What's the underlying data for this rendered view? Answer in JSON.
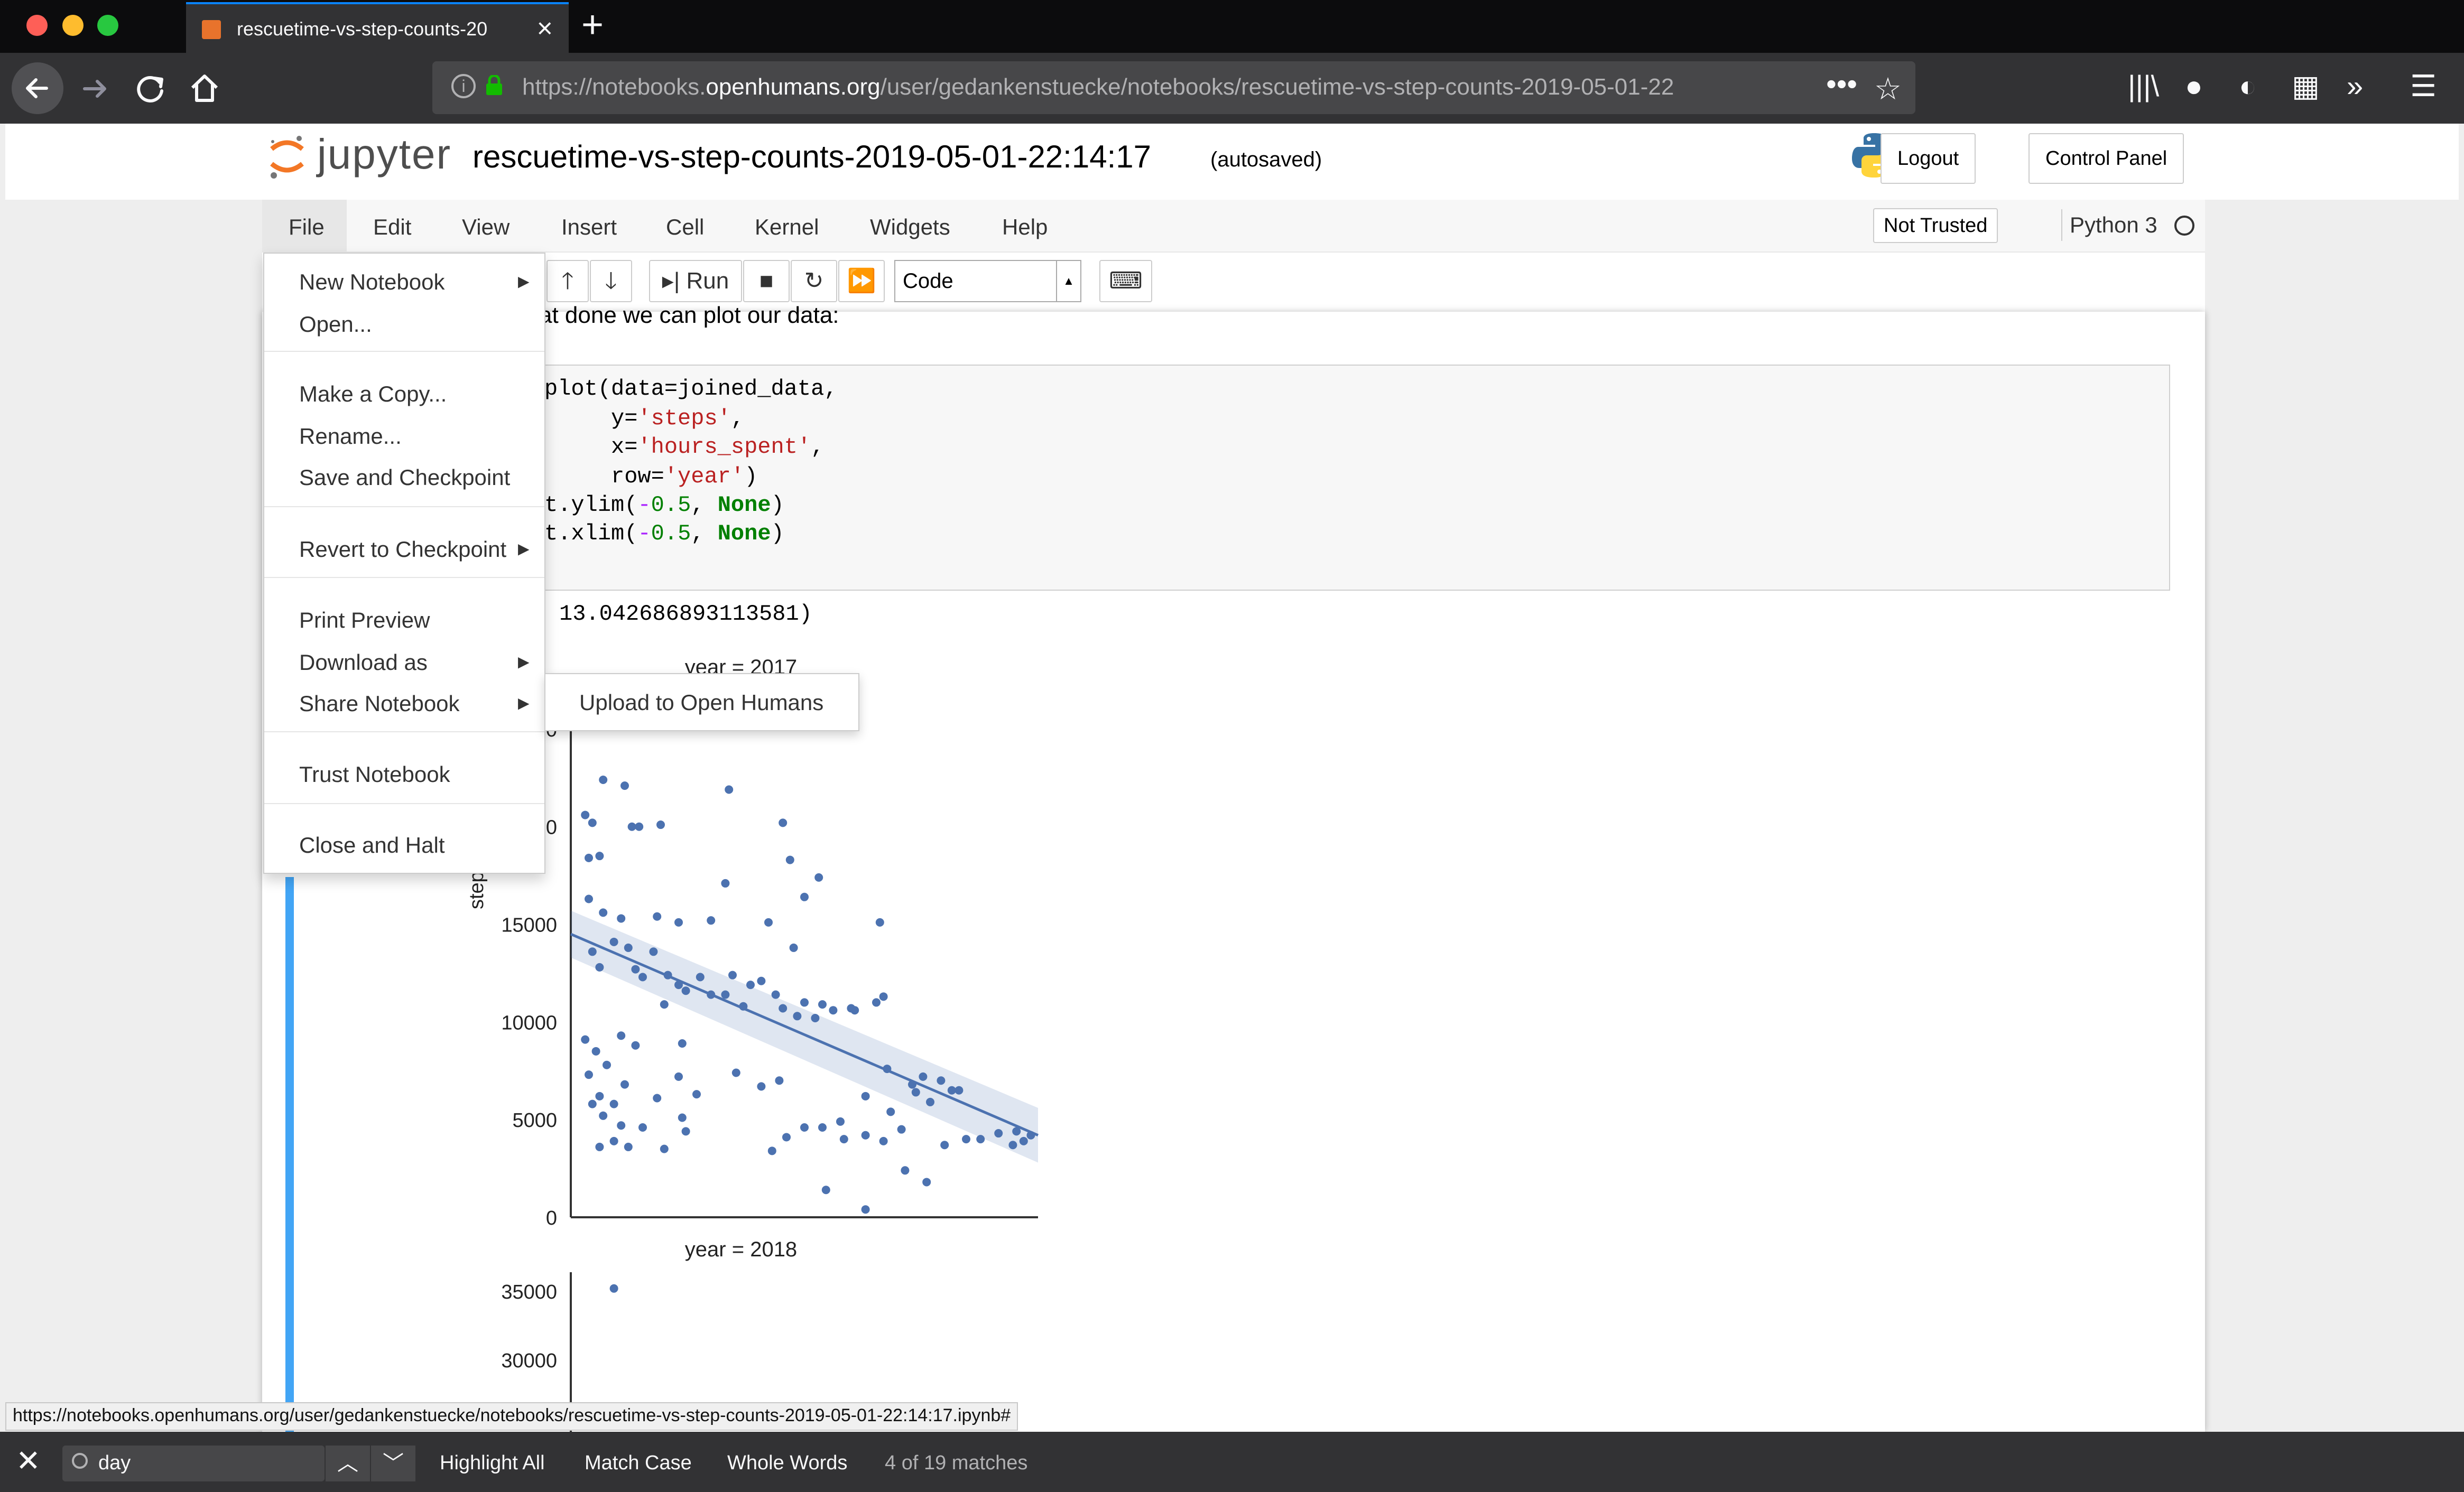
{
  "browser": {
    "tab_title": "rescuetime-vs-step-counts-20",
    "url_prefix": "https://notebooks.",
    "url_domain": "openhumans.org",
    "url_rest": "/user/gedankenstuecke/notebooks/rescuetime-vs-step-counts-2019-05-01-22",
    "status_url": "https://notebooks.openhumans.org/user/gedankenstuecke/notebooks/rescuetime-vs-step-counts-2019-05-01-22:14:17.ipynb#"
  },
  "jupyter": {
    "logo_text": "jupyter",
    "notebook_name": "rescuetime-vs-step-counts-2019-05-01-22:14:17",
    "autosaved": "(autosaved)",
    "logout": "Logout",
    "control_panel": "Control Panel",
    "menus": [
      "File",
      "Edit",
      "View",
      "Insert",
      "Cell",
      "Kernel",
      "Widgets",
      "Help"
    ],
    "not_trusted": "Not Trusted",
    "kernel": "Python 3",
    "run_label": "Run",
    "cell_type": "Code"
  },
  "file_menu": {
    "new_notebook": "New Notebook",
    "open": "Open...",
    "make_copy": "Make a Copy...",
    "rename": "Rename...",
    "save_checkpoint": "Save and Checkpoint",
    "revert": "Revert to Checkpoint",
    "print_preview": "Print Preview",
    "download_as": "Download as",
    "share_notebook": "Share Notebook",
    "trust_notebook": "Trust Notebook",
    "close_halt": "Close and Halt",
    "share_submenu_item": "Upload to Open Humans"
  },
  "notebook": {
    "markdown_text": "at done we can plot our data:",
    "code_lines": [
      {
        "a": "plot(data=joined_data,",
        "b": "",
        "c": ""
      },
      {
        "a": "     y=",
        "b": "'steps'",
        "c": ","
      },
      {
        "a": "     x=",
        "b": "'hours_spent'",
        "c": ","
      },
      {
        "a": "     row=",
        "b": "'year'",
        "c": ")"
      }
    ],
    "ylim_line": {
      "pre": "t.ylim(",
      "minus": "-",
      "num": "0.5",
      "sep": ", ",
      "kw": "None",
      "post": ")"
    },
    "xlim_line": {
      "pre": "t.xlim(",
      "minus": "-",
      "num": "0.5",
      "sep": ", ",
      "kw": "None",
      "post": ")"
    },
    "output_text": "13.042686893113581)"
  },
  "chart_data": [
    {
      "type": "scatter",
      "title": "year = 2017",
      "ylabel": "steps",
      "yticks": [
        0,
        5000,
        10000,
        15000,
        20000
      ],
      "ylim": [
        0,
        27000
      ],
      "xlim": [
        0,
        13
      ],
      "point_color": "#4c72b0",
      "regression": {
        "x0": 0,
        "y0": 14500,
        "x1": 13,
        "y1": 4200
      },
      "points": [
        [
          0.4,
          20600
        ],
        [
          0.6,
          20200
        ],
        [
          0.5,
          18400
        ],
        [
          0.8,
          18500
        ],
        [
          0.9,
          22400
        ],
        [
          1.5,
          22100
        ],
        [
          1.7,
          20000
        ],
        [
          1.9,
          20000
        ],
        [
          2.5,
          20100
        ],
        [
          4.4,
          21900
        ],
        [
          5.9,
          20200
        ],
        [
          0.5,
          16300
        ],
        [
          0.9,
          15600
        ],
        [
          1.4,
          15300
        ],
        [
          2.4,
          15400
        ],
        [
          3.0,
          15100
        ],
        [
          3.9,
          15200
        ],
        [
          4.3,
          17100
        ],
        [
          5.5,
          15100
        ],
        [
          6.1,
          18300
        ],
        [
          6.5,
          16400
        ],
        [
          6.9,
          17400
        ],
        [
          8.6,
          15100
        ],
        [
          0.6,
          13600
        ],
        [
          0.8,
          12800
        ],
        [
          1.2,
          14100
        ],
        [
          1.6,
          13800
        ],
        [
          1.8,
          12700
        ],
        [
          2.0,
          12300
        ],
        [
          2.3,
          13600
        ],
        [
          2.7,
          12400
        ],
        [
          3.0,
          11900
        ],
        [
          3.2,
          11600
        ],
        [
          3.6,
          12300
        ],
        [
          3.9,
          11400
        ],
        [
          4.3,
          11400
        ],
        [
          4.5,
          12400
        ],
        [
          4.8,
          10800
        ],
        [
          5.3,
          12100
        ],
        [
          5.7,
          11400
        ],
        [
          6.2,
          13800
        ],
        [
          6.5,
          11000
        ],
        [
          6.8,
          10200
        ],
        [
          7.3,
          10600
        ],
        [
          7.9,
          10600
        ],
        [
          8.5,
          11000
        ],
        [
          8.7,
          11300
        ],
        [
          0.4,
          9100
        ],
        [
          0.7,
          8500
        ],
        [
          1.0,
          7800
        ],
        [
          1.4,
          9300
        ],
        [
          1.8,
          8800
        ],
        [
          2.6,
          10900
        ],
        [
          3.1,
          8900
        ],
        [
          5.0,
          11900
        ],
        [
          5.9,
          10700
        ],
        [
          6.3,
          10300
        ],
        [
          7.0,
          10900
        ],
        [
          7.8,
          10700
        ],
        [
          0.5,
          7300
        ],
        [
          0.8,
          6200
        ],
        [
          1.2,
          5800
        ],
        [
          1.5,
          6800
        ],
        [
          2.4,
          6100
        ],
        [
          3.0,
          7200
        ],
        [
          4.6,
          7400
        ],
        [
          5.3,
          6700
        ],
        [
          5.8,
          7000
        ],
        [
          8.2,
          6200
        ],
        [
          8.8,
          7600
        ],
        [
          9.5,
          6800
        ],
        [
          9.8,
          7200
        ],
        [
          10.3,
          7000
        ],
        [
          10.8,
          6500
        ],
        [
          0.6,
          5800
        ],
        [
          0.9,
          5200
        ],
        [
          1.4,
          4700
        ],
        [
          2.0,
          4600
        ],
        [
          3.1,
          5100
        ],
        [
          3.5,
          6300
        ],
        [
          7.5,
          4900
        ],
        [
          8.9,
          5400
        ],
        [
          9.6,
          6400
        ],
        [
          10.0,
          5900
        ],
        [
          10.6,
          6500
        ],
        [
          0.8,
          3600
        ],
        [
          1.2,
          3900
        ],
        [
          1.6,
          3600
        ],
        [
          2.6,
          3500
        ],
        [
          3.2,
          4400
        ],
        [
          5.6,
          3400
        ],
        [
          6.0,
          4100
        ],
        [
          6.5,
          4600
        ],
        [
          7.0,
          4600
        ],
        [
          7.6,
          4000
        ],
        [
          8.2,
          4200
        ],
        [
          8.7,
          3900
        ],
        [
          9.2,
          4500
        ],
        [
          10.4,
          3700
        ],
        [
          11.0,
          4000
        ],
        [
          11.4,
          4000
        ],
        [
          11.9,
          4300
        ],
        [
          12.4,
          4400
        ],
        [
          12.8,
          4200
        ],
        [
          12.3,
          3700
        ],
        [
          12.6,
          3900
        ],
        [
          7.1,
          1400
        ],
        [
          8.2,
          400
        ],
        [
          9.3,
          2400
        ],
        [
          9.9,
          1800
        ]
      ]
    },
    {
      "type": "scatter",
      "title": "year = 2018",
      "yticks": [
        30000,
        35000
      ],
      "point_color": "#4c72b0",
      "points": [
        [
          1.2,
          35200
        ]
      ]
    }
  ],
  "findbar": {
    "query": "day",
    "highlight_all": "Highlight All",
    "match_case": "Match Case",
    "whole_words": "Whole Words",
    "match_count": "4 of 19 matches"
  }
}
